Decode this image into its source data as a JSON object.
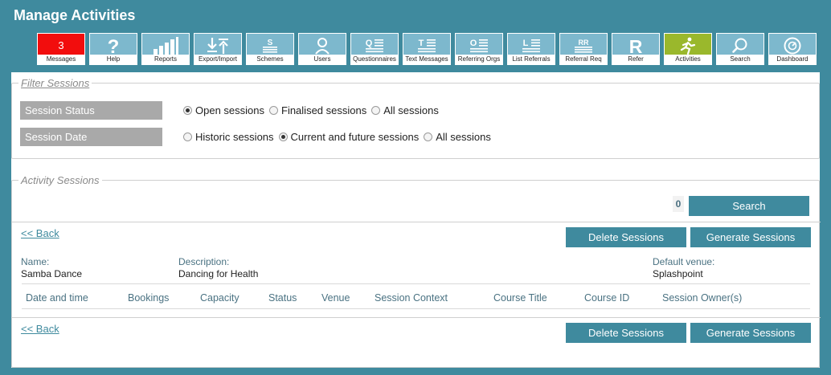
{
  "page": {
    "title": "Manage Activities"
  },
  "toolbar": [
    {
      "key": "messages",
      "label": "Messages",
      "count": "3",
      "icon": "count-badge"
    },
    {
      "key": "help",
      "label": "Help",
      "icon": "question-icon"
    },
    {
      "key": "reports",
      "label": "Reports",
      "icon": "bar-chart-icon"
    },
    {
      "key": "export-import",
      "label": "Export/Import",
      "icon": "export-import-icon"
    },
    {
      "key": "schemes",
      "label": "Schemes",
      "icon": "schemes-icon"
    },
    {
      "key": "users",
      "label": "Users",
      "icon": "user-icon"
    },
    {
      "key": "questionnaires",
      "label": "Questionnaires",
      "icon": "questionnaire-icon"
    },
    {
      "key": "text-messages",
      "label": "Text Messages",
      "icon": "text-message-icon"
    },
    {
      "key": "referring-orgs",
      "label": "Referring Orgs",
      "icon": "referring-orgs-icon"
    },
    {
      "key": "list-referrals",
      "label": "List Referrals",
      "icon": "list-referrals-icon"
    },
    {
      "key": "referral-req",
      "label": "Referral Req",
      "icon": "referral-req-icon"
    },
    {
      "key": "refer",
      "label": "Refer",
      "icon": "refer-icon"
    },
    {
      "key": "activities",
      "label": "Activities",
      "icon": "running-man-icon"
    },
    {
      "key": "search",
      "label": "Search",
      "icon": "magnifier-icon"
    },
    {
      "key": "dashboard",
      "label": "Dashboard",
      "icon": "gauge-icon"
    }
  ],
  "filter": {
    "legend": "Filter Sessions",
    "status": {
      "label": "Session Status",
      "options": [
        "Open sessions",
        "Finalised sessions",
        "All sessions"
      ],
      "selected": "Open sessions"
    },
    "date": {
      "label": "Session Date",
      "options": [
        "Historic sessions",
        "Current and future sessions",
        "All sessions"
      ],
      "selected": "Current and future sessions"
    }
  },
  "sessions": {
    "legend": "Activity Sessions",
    "count": "0",
    "search_label": "Search",
    "back_label": "<< Back",
    "delete_label": "Delete Sessions",
    "generate_label": "Generate Sessions",
    "activity": {
      "name_label": "Name:",
      "name": "Samba Dance",
      "description_label": "Description:",
      "description": "Dancing for Health",
      "venue_label": "Default venue:",
      "venue": "Splashpoint"
    },
    "columns": [
      "Date and time",
      "Bookings",
      "Capacity",
      "Status",
      "Venue",
      "Session Context",
      "Course Title",
      "Course ID",
      "Session Owner(s)"
    ]
  },
  "colors": {
    "brand": "#3f8a9e",
    "toolbar_tile": "#7db8cd",
    "messages_tile": "#f20d0d",
    "active_tile": "#9ab82c",
    "filter_label_bg": "#a9a9a9"
  }
}
